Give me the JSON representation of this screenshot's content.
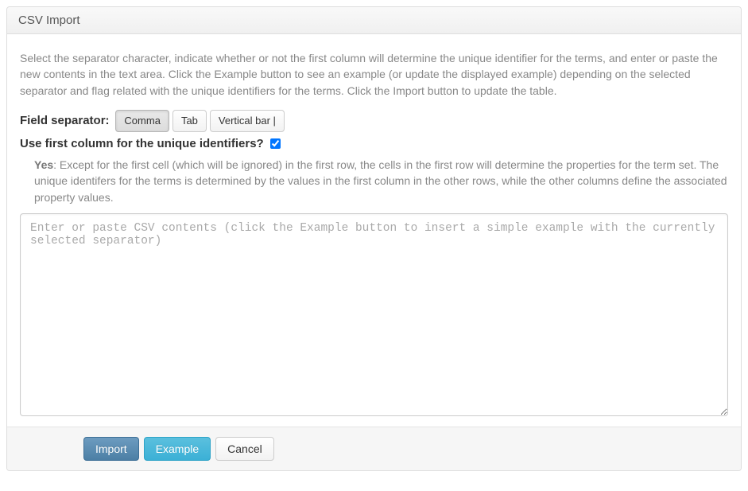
{
  "header": {
    "title": "CSV Import"
  },
  "intro": "Select the separator character, indicate whether or not the first column will determine the unique identifier for the terms, and enter or paste the new contents in the text area. Click the Example button to see an example (or update the displayed example) depending on the selected separator and flag related with the unique identifiers for the terms. Click the Import button to update the table.",
  "field_separator": {
    "label": "Field separator:",
    "options": {
      "comma": "Comma",
      "tab": "Tab",
      "vbar": "Vertical bar |"
    },
    "selected": "comma"
  },
  "use_first_col": {
    "label": "Use first column for the unique identifiers?",
    "checked": true,
    "help_prefix": "Yes",
    "help_text": ": Except for the first cell (which will be ignored) in the first row, the cells in the first row will determine the properties for the term set. The unique identifers for the terms is determined by the values in the first column in the other rows, while the other columns define the associated property values."
  },
  "csv_area": {
    "placeholder": "Enter or paste CSV contents (click the Example button to insert a simple example with the currently selected separator)",
    "value": ""
  },
  "footer": {
    "import": "Import",
    "example": "Example",
    "cancel": "Cancel"
  }
}
